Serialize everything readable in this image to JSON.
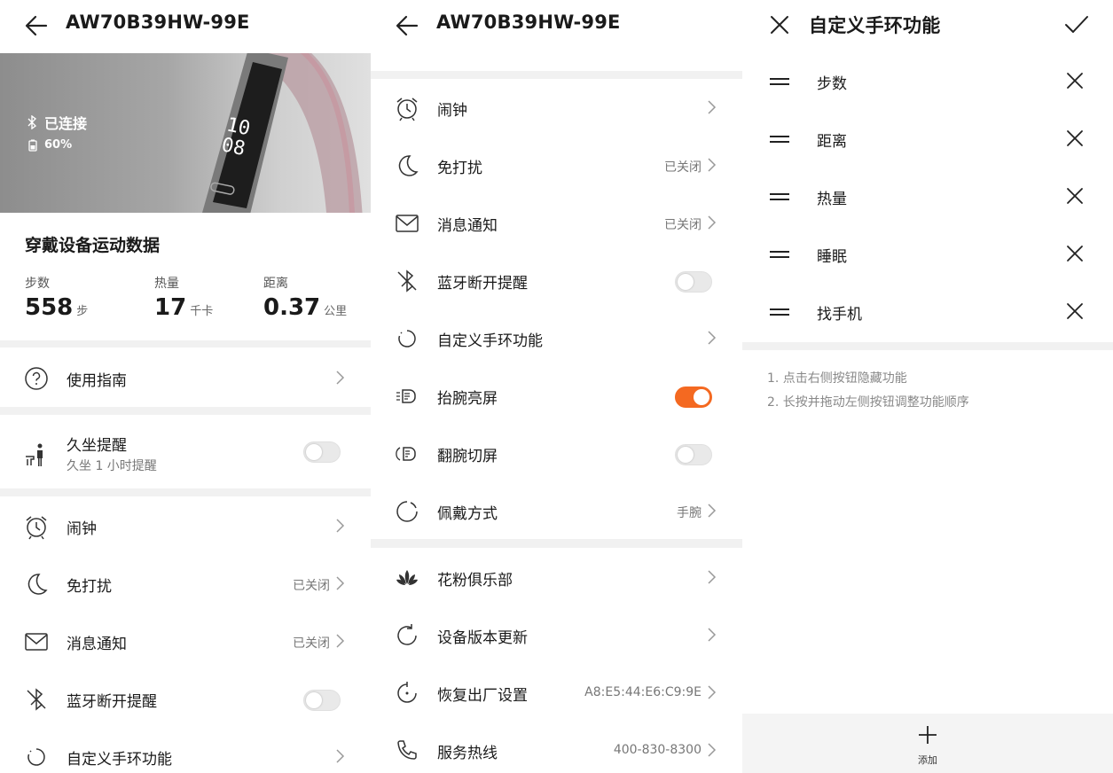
{
  "device_name": "AW70B39HW-99E",
  "panel1": {
    "status": "已连接",
    "battery": "60%",
    "band_time_top": "10",
    "band_time_bottom": "08",
    "section_title": "穿戴设备运动数据",
    "stats": [
      {
        "label": "步数",
        "value": "558",
        "unit": "步"
      },
      {
        "label": "热量",
        "value": "17",
        "unit": "千卡"
      },
      {
        "label": "距离",
        "value": "0.37",
        "unit": "公里"
      }
    ],
    "guide": "使用指南",
    "sedentary": {
      "label": "久坐提醒",
      "sub": "久坐 1 小时提醒",
      "enabled": false
    },
    "rows": [
      {
        "label": "闹钟",
        "value": "",
        "icon": "alarm-clock-icon"
      },
      {
        "label": "免打扰",
        "value": "已关闭",
        "icon": "moon-icon"
      },
      {
        "label": "消息通知",
        "value": "已关闭",
        "icon": "envelope-icon"
      },
      {
        "label": "蓝牙断开提醒",
        "value": "",
        "icon": "bluetooth-off-icon",
        "toggle": false
      },
      {
        "label": "自定义手环功能",
        "value": "",
        "icon": "circle-icon"
      }
    ]
  },
  "panel2": {
    "rows": [
      {
        "label": "闹钟",
        "value": "",
        "icon": "alarm-clock-icon"
      },
      {
        "label": "免打扰",
        "value": "已关闭",
        "icon": "moon-icon"
      },
      {
        "label": "消息通知",
        "value": "已关闭",
        "icon": "envelope-icon"
      },
      {
        "label": "蓝牙断开提醒",
        "value": "",
        "icon": "bluetooth-off-icon",
        "toggle": false
      },
      {
        "label": "自定义手环功能",
        "value": "",
        "icon": "circle-icon"
      },
      {
        "label": "抬腕亮屏",
        "value": "",
        "icon": "wrist-raise-icon",
        "toggle": true
      },
      {
        "label": "翻腕切屏",
        "value": "",
        "icon": "wrist-flip-icon",
        "toggle": false
      },
      {
        "label": "佩戴方式",
        "value": "手腕",
        "icon": "wear-circle-icon"
      },
      {
        "label": "花粉俱乐部",
        "value": "",
        "icon": "lotus-icon"
      },
      {
        "label": "设备版本更新",
        "value": "",
        "icon": "update-icon"
      },
      {
        "label": "恢复出厂设置",
        "value": "A8:E5:44:E6:C9:9E",
        "icon": "reset-icon"
      },
      {
        "label": "服务热线",
        "value": "400-830-8300",
        "icon": "phone-icon"
      }
    ]
  },
  "panel3": {
    "title": "自定义手环功能",
    "items": [
      "步数",
      "距离",
      "热量",
      "睡眠",
      "找手机"
    ],
    "hints": [
      "1. 点击右侧按钮隐藏功能",
      "2. 长按并拖动左侧按钮调整功能顺序"
    ],
    "add_label": "添加"
  },
  "colors": {
    "accent": "#f46921",
    "separator": "#f1f1f1"
  }
}
